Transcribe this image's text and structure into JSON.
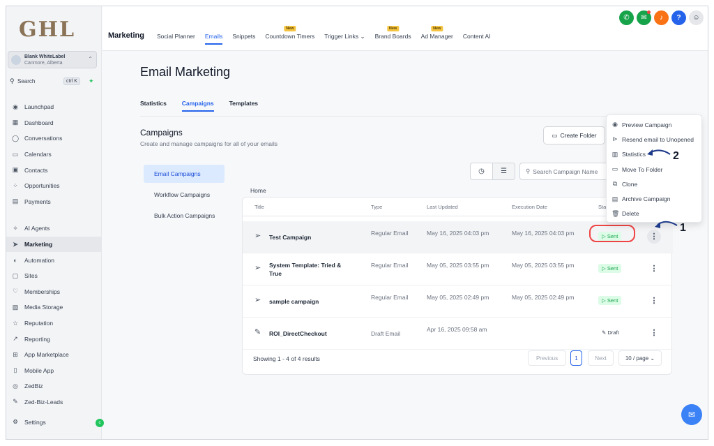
{
  "logo": "GHL",
  "account": {
    "name": "Blank WhiteLabel",
    "location": "Canmore, Alberta"
  },
  "search": {
    "label": "Search",
    "shortcut": "ctrl K"
  },
  "nav": {
    "group1": [
      {
        "label": "Launchpad",
        "icon": "rocket-icon"
      },
      {
        "label": "Dashboard",
        "icon": "dashboard-icon"
      },
      {
        "label": "Conversations",
        "icon": "chat-icon"
      },
      {
        "label": "Calendars",
        "icon": "calendar-icon"
      },
      {
        "label": "Contacts",
        "icon": "contacts-icon"
      },
      {
        "label": "Opportunities",
        "icon": "opportunities-icon"
      },
      {
        "label": "Payments",
        "icon": "payments-icon"
      }
    ],
    "group2": [
      {
        "label": "AI Agents",
        "icon": "sparkle-icon"
      },
      {
        "label": "Marketing",
        "icon": "send-icon"
      },
      {
        "label": "Automation",
        "icon": "automation-icon"
      },
      {
        "label": "Sites",
        "icon": "sites-icon"
      },
      {
        "label": "Memberships",
        "icon": "memberships-icon"
      },
      {
        "label": "Media Storage",
        "icon": "media-icon"
      },
      {
        "label": "Reputation",
        "icon": "star-icon"
      },
      {
        "label": "Reporting",
        "icon": "chart-icon"
      },
      {
        "label": "App Marketplace",
        "icon": "apps-icon"
      },
      {
        "label": "Mobile App",
        "icon": "mobile-icon"
      },
      {
        "label": "ZedBiz",
        "icon": "zedbiz-icon"
      },
      {
        "label": "Zed-Biz-Leads",
        "icon": "wrench-icon"
      }
    ],
    "active": "Marketing",
    "settings": "Settings",
    "settings_badge": "c"
  },
  "topbar": {
    "title": "Marketing",
    "links": [
      {
        "label": "Social Planner",
        "new": false
      },
      {
        "label": "Emails",
        "new": false,
        "active": true
      },
      {
        "label": "Snippets",
        "new": false
      },
      {
        "label": "Countdown Timers",
        "new": true
      },
      {
        "label": "Trigger Links ⌄",
        "new": false
      },
      {
        "label": "Brand Boards",
        "new": true
      },
      {
        "label": "Ad Manager",
        "new": true
      },
      {
        "label": "Content AI",
        "new": false
      }
    ],
    "new_label": "New"
  },
  "page": {
    "title": "Email Marketing",
    "tabs": [
      "Statistics",
      "Campaigns",
      "Templates"
    ],
    "section_title": "Campaigns",
    "section_sub": "Create and manage campaigns for all of your emails",
    "create_folder": "Create Folder",
    "left_menu": [
      "Email Campaigns",
      "Workflow Campaigns",
      "Bulk Action Campaigns"
    ],
    "search_placeholder": "Search Campaign Name",
    "breadcrumb": "Home"
  },
  "table": {
    "headers": {
      "title": "Title",
      "type": "Type",
      "updated": "Last Updated",
      "exec": "Execution Date",
      "status": "Sta"
    },
    "rows": [
      {
        "title": "Test Campaign",
        "type": "Regular Email",
        "updated": "May 16, 2025 04:03 pm",
        "exec": "May 16, 2025 04:03 pm",
        "status": "Sent"
      },
      {
        "title": "System Template: Tried & True",
        "type": "Regular Email",
        "updated": "May 05, 2025 03:55 pm",
        "exec": "May 05, 2025 03:55 pm",
        "status": "Sent"
      },
      {
        "title": "sample campaign",
        "type": "Regular Email",
        "updated": "May 05, 2025 02:49 pm",
        "exec": "May 05, 2025 02:49 pm",
        "status": "Sent"
      },
      {
        "title": "ROI_DirectCheckout",
        "type": "Draft Email",
        "updated": "Apr 16, 2025 09:58 am",
        "exec": "",
        "status": "Draft"
      }
    ],
    "showing": "Showing 1 - 4 of 4 results",
    "pagination": {
      "prev": "Previous",
      "page": "1",
      "next": "Next",
      "per_page": "10 / page ⌄"
    }
  },
  "context_menu": [
    "Preview Campaign",
    "Resend email to Unopened",
    "Statistics",
    "Move To Folder",
    "Clone",
    "Archive Campaign",
    "Delete"
  ],
  "annotations": {
    "one": "1",
    "two": "2"
  },
  "colors": {
    "accent": "#2563eb",
    "sent": "#16a34a",
    "annotation": "#ef4444"
  }
}
